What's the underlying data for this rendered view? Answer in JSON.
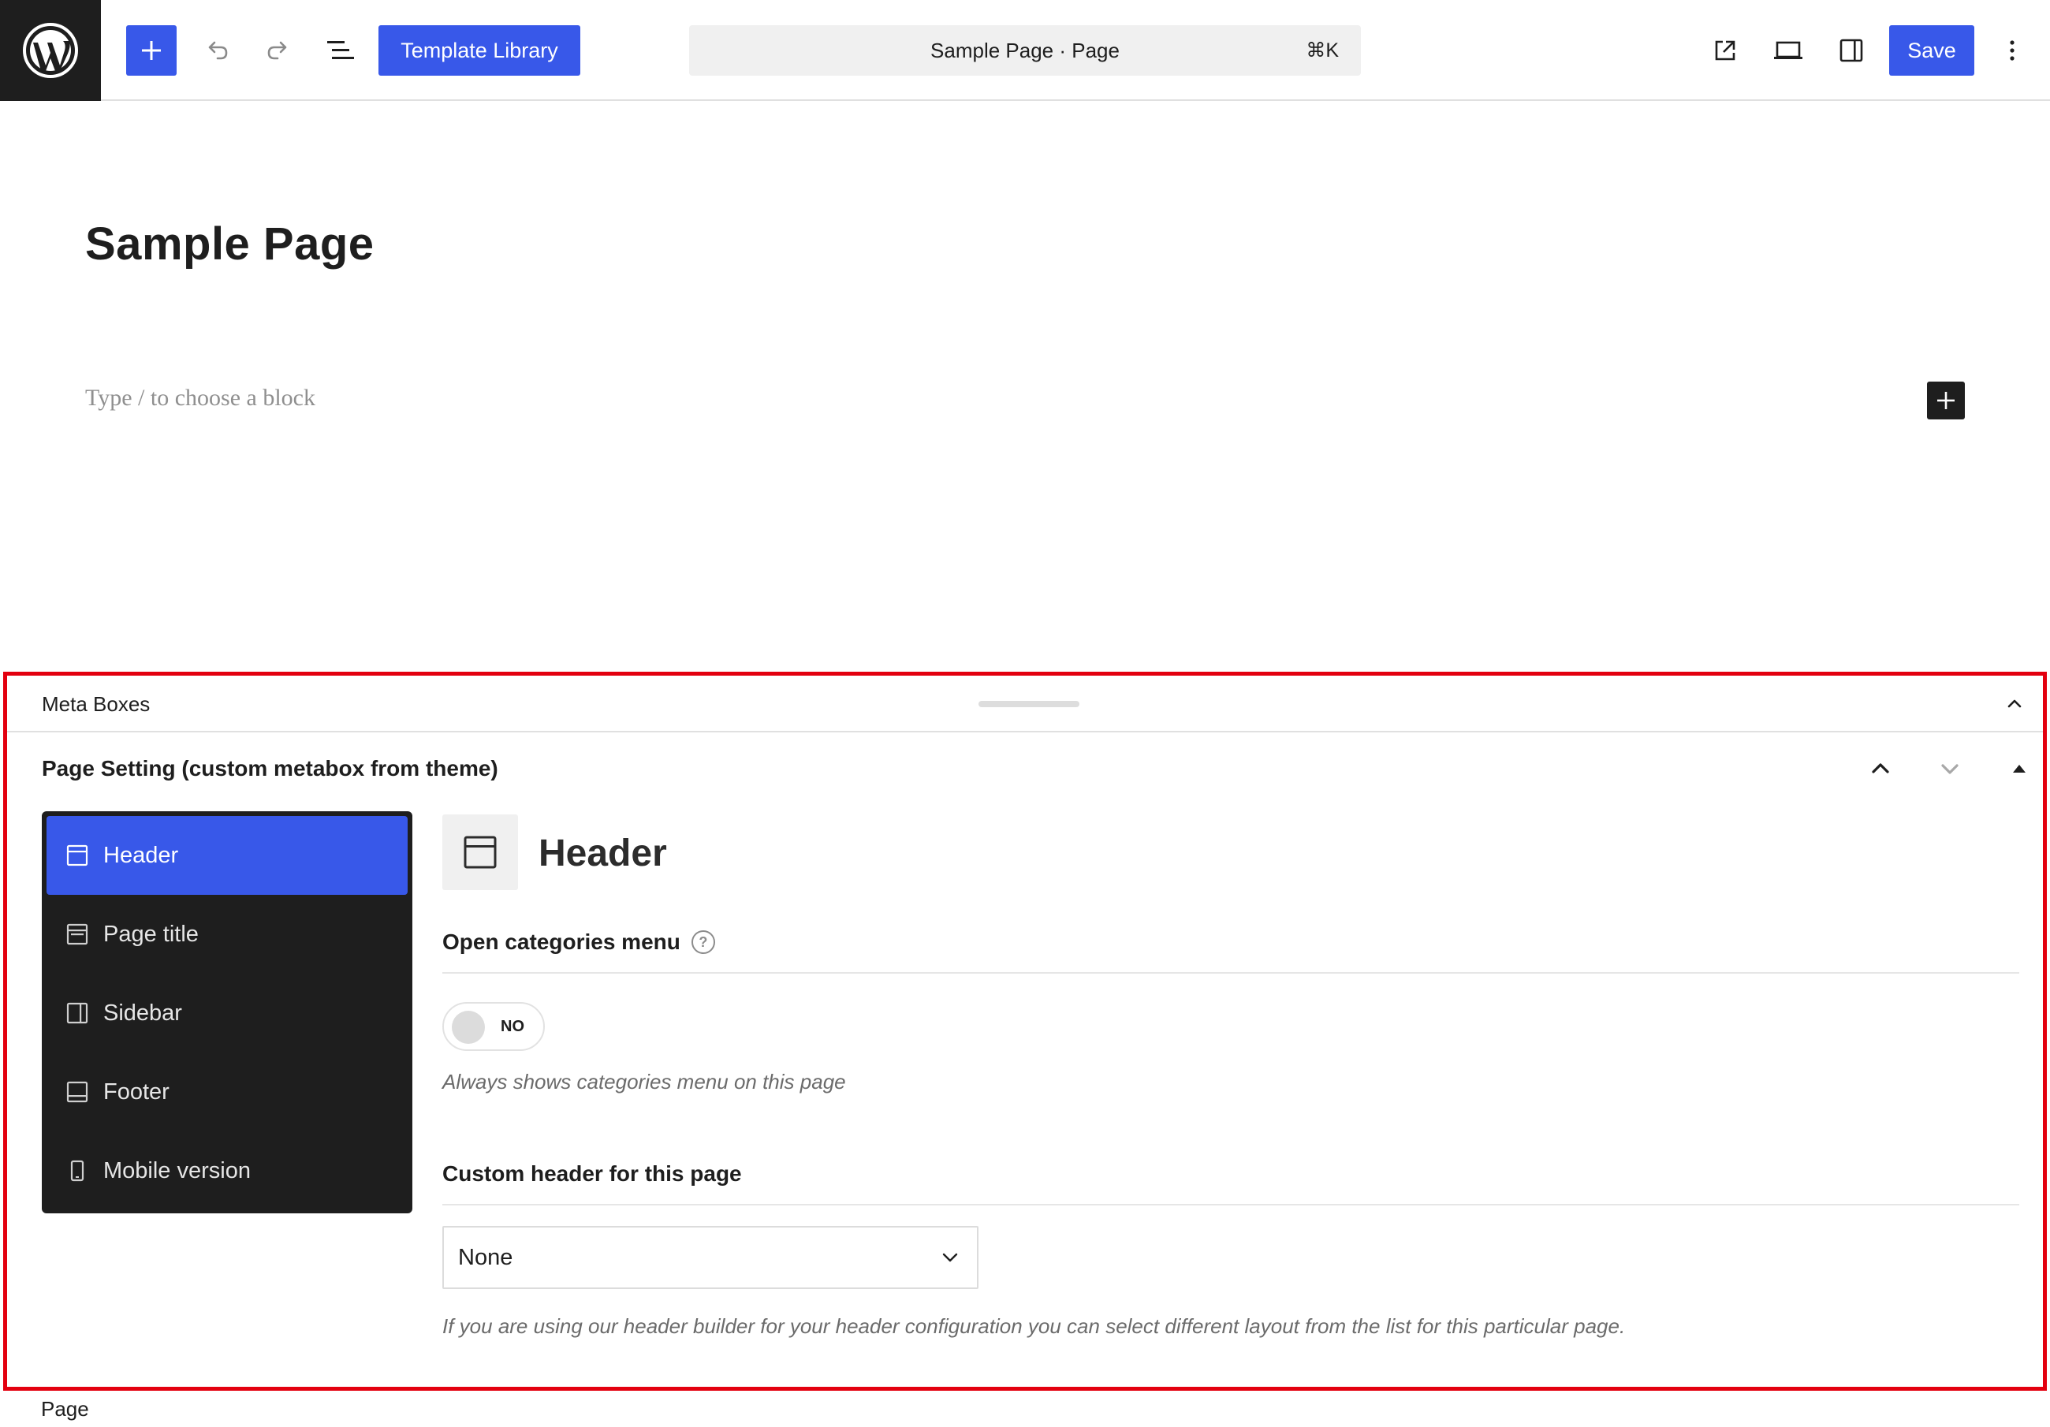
{
  "toolbar": {
    "template_library_label": "Template Library",
    "document_title": "Sample Page · Page",
    "shortcut": "⌘K",
    "save_label": "Save",
    "accent_color": "#3858e9"
  },
  "editor": {
    "post_title": "Sample Page",
    "block_placeholder": "Type / to choose a block"
  },
  "meta_boxes": {
    "title": "Meta Boxes",
    "panel": {
      "title": "Page Setting (custom metabox from theme)",
      "nav_items": [
        {
          "label": "Header",
          "icon": "header-layout-icon",
          "active": true
        },
        {
          "label": "Page title",
          "icon": "page-title-layout-icon",
          "active": false
        },
        {
          "label": "Sidebar",
          "icon": "sidebar-layout-icon",
          "active": false
        },
        {
          "label": "Footer",
          "icon": "footer-layout-icon",
          "active": false
        },
        {
          "label": "Mobile version",
          "icon": "mobile-icon",
          "active": false
        }
      ],
      "section_title": "Header",
      "fields": {
        "categories_menu": {
          "label": "Open categories menu",
          "help_glyph": "?",
          "toggle_text": "NO",
          "help_text": "Always shows categories menu on this page"
        },
        "custom_header": {
          "label": "Custom header for this page",
          "selected": "None",
          "help_text": "If you are using our header builder for your header configuration you can select different layout from the list for this particular page."
        }
      }
    }
  },
  "footer": {
    "breadcrumb": "Page"
  }
}
